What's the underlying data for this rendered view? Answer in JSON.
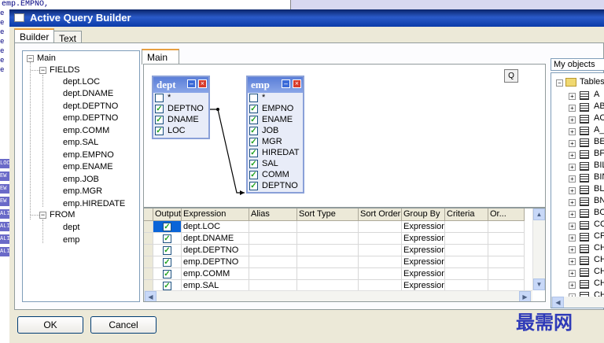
{
  "background": {
    "code_text": "emp.EMPNO,",
    "left_letters": [
      "e",
      "e",
      "e",
      "e",
      "e",
      "e",
      "e"
    ],
    "side_tags": [
      "LOC",
      "EW",
      "EW",
      "EW",
      "ALI",
      "ALI",
      "ALI",
      "ALI"
    ]
  },
  "window": {
    "title": "Active Query Builder",
    "tabs": [
      "Builder",
      "Text"
    ]
  },
  "tree": {
    "root": "Main",
    "fields_label": "FIELDS",
    "fields": [
      "dept.LOC",
      "dept.DNAME",
      "dept.DEPTNO",
      "emp.DEPTNO",
      "emp.COMM",
      "emp.SAL",
      "emp.EMPNO",
      "emp.ENAME",
      "emp.JOB",
      "emp.MGR",
      "emp.HIREDATE"
    ],
    "from_label": "FROM",
    "from": [
      "dept",
      "emp"
    ]
  },
  "diagram": {
    "tab_label": "Main",
    "query_button": "Q",
    "tables": [
      {
        "name": "dept",
        "columns": [
          "*",
          "DEPTNO",
          "DNAME",
          "LOC"
        ],
        "checked": [
          false,
          true,
          true,
          true
        ]
      },
      {
        "name": "emp",
        "columns": [
          "*",
          "EMPNO",
          "ENAME",
          "JOB",
          "MGR",
          "HIREDAT",
          "SAL",
          "COMM",
          "DEPTNO"
        ],
        "checked": [
          false,
          true,
          true,
          true,
          true,
          true,
          true,
          true,
          true
        ]
      }
    ]
  },
  "grid": {
    "headers": [
      "Output",
      "Expression",
      "Alias",
      "Sort Type",
      "Sort Order",
      "Group By",
      "Criteria",
      "Or..."
    ],
    "rows": [
      {
        "output": true,
        "expression": "dept.LOC",
        "group_by": "Expression"
      },
      {
        "output": true,
        "expression": "dept.DNAME",
        "group_by": "Expression"
      },
      {
        "output": true,
        "expression": "dept.DEPTNO",
        "group_by": "Expression"
      },
      {
        "output": true,
        "expression": "emp.DEPTNO",
        "group_by": "Expression"
      },
      {
        "output": true,
        "expression": "emp.COMM",
        "group_by": "Expression"
      },
      {
        "output": true,
        "expression": "emp.SAL",
        "group_by": "Expression"
      }
    ]
  },
  "objects": {
    "label": "My objects",
    "tables_label": "Tables",
    "items": [
      "A",
      "ABC",
      "ACTI",
      "A_W",
      "BEFU",
      "BFILI",
      "BILLE",
      "BINF",
      "BLOE",
      "BN",
      "BON",
      "CCAL",
      "CFG_",
      "CHA",
      "CHA",
      "CHA",
      "CHA",
      "CHAI"
    ]
  },
  "buttons": {
    "ok": "OK",
    "cancel": "Cancel"
  },
  "watermark": "最需网",
  "colors": {
    "title_bar": "#0a246a",
    "check": "#21a121",
    "table_header": "#5a7ed8"
  }
}
